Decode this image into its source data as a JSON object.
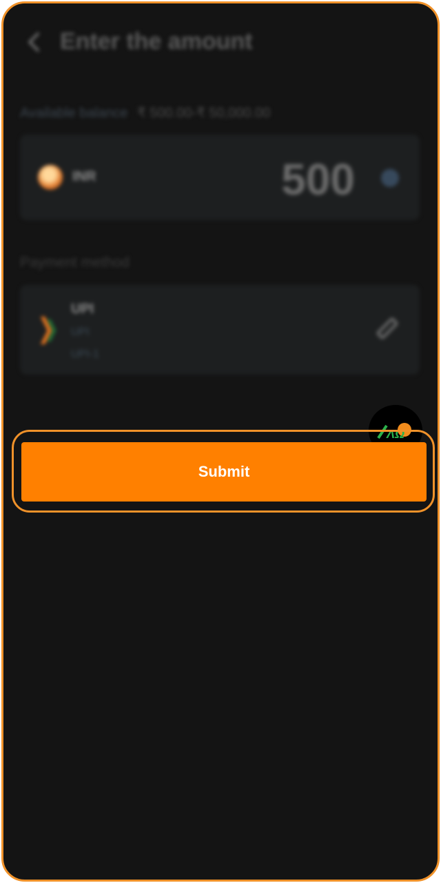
{
  "header": {
    "title": "Enter the amount"
  },
  "balance": {
    "label": "Available balance",
    "range": "₹ 500.00-₹ 50,000.00"
  },
  "amount_card": {
    "currency": "INR",
    "value": "500"
  },
  "payment": {
    "label": "Payment method",
    "method_name": "UPI",
    "method_sub1": "UPI",
    "method_sub2": "UPI-1"
  },
  "submit": {
    "label": "Submit"
  },
  "colors": {
    "accent": "#ff8000",
    "frame": "#f0922a",
    "background": "#141414",
    "card": "#1d1f20"
  },
  "icons": [
    "back-icon",
    "coin-icon",
    "clear-icon",
    "upi-logo-icon",
    "edit-icon",
    "chat-icon"
  ]
}
